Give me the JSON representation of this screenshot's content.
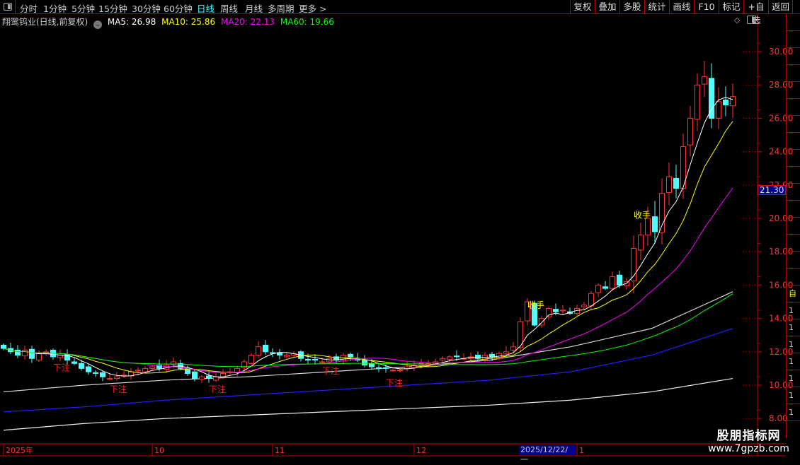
{
  "toolbar": {
    "periods": [
      "分时",
      "1分钟",
      "5分钟",
      "15分钟",
      "30分钟",
      "60分钟",
      "日线",
      "周线",
      "月线",
      "多周期",
      "更多 >"
    ],
    "active_period": "日线",
    "buttons": [
      "复权",
      "叠加",
      "多股",
      "统计",
      "画线",
      "F10",
      "标记",
      "+自选",
      "返回"
    ]
  },
  "info": {
    "title": "翔鹭钨业(日线,前复权)",
    "ma5": "MA5: 26.98",
    "ma10": "MA10: 25.86",
    "ma20": "MA20: 22.13",
    "ma60": "MA60: 19.66"
  },
  "colors": {
    "up": "#ff3232",
    "down": "#54fcfc",
    "ma5": "#ffffff",
    "ma10": "#ffff00",
    "ma20": "#ff00ff",
    "ma60": "#00ff00",
    "axis": "#ff3232",
    "signal_buy": "#ff2020",
    "signal_sell": "#ffff00"
  },
  "price_tag": "21.30",
  "date_tag": "2025/12/22/一",
  "right_strip": [
    "自",
    "1",
    "1",
    "1",
    "1",
    "1",
    "1",
    "1"
  ],
  "watermark": {
    "line1": "股朋指标网",
    "line2": "www.7gpzb.com"
  },
  "chart_data": {
    "type": "candlestick",
    "ylim": [
      7.5,
      31.5
    ],
    "yticks": [
      "8.00",
      "10.00",
      "12.00",
      "14.00",
      "16.00",
      "18.00",
      "20.00",
      "22.00",
      "24.00",
      "26.00",
      "28.00",
      "30.00"
    ],
    "xticks": [
      {
        "index": 0,
        "label": "2025年"
      },
      {
        "index": 21,
        "label": "10"
      },
      {
        "index": 38,
        "label": "11"
      },
      {
        "index": 58,
        "label": "12"
      },
      {
        "index": 81,
        "label": "1"
      }
    ],
    "closes": [
      12.2,
      12.0,
      11.8,
      12.1,
      11.6,
      11.9,
      12.0,
      11.7,
      11.8,
      11.5,
      11.3,
      11.0,
      10.8,
      10.7,
      10.5,
      10.4,
      10.5,
      10.6,
      10.8,
      10.9,
      11.0,
      11.1,
      11.0,
      11.2,
      11.4,
      11.0,
      10.7,
      10.4,
      10.5,
      10.4,
      10.5,
      10.7,
      10.8,
      11.0,
      11.4,
      11.8,
      12.3,
      12.0,
      11.9,
      11.8,
      11.8,
      11.9,
      11.6,
      11.5,
      11.5,
      11.4,
      11.6,
      11.5,
      11.8,
      11.7,
      11.5,
      11.2,
      11.1,
      11.0,
      11.0,
      10.9,
      10.9,
      11.1,
      11.2,
      11.3,
      11.3,
      11.4,
      11.6,
      11.7,
      11.7,
      11.6,
      11.7,
      11.6,
      11.8,
      11.7,
      11.9,
      12.0,
      12.3,
      13.8,
      15.0,
      13.6,
      14.0,
      14.6,
      14.4,
      14.5,
      14.3,
      14.6,
      14.8,
      15.5,
      16.0,
      15.8,
      16.5,
      16.0,
      16.2,
      18.2,
      19.0,
      20.0,
      19.2,
      21.5,
      22.5,
      21.8,
      24.3,
      26.0,
      28.0,
      28.5,
      26.0,
      27.0,
      26.8,
      27.3
    ],
    "long_lines": [
      {
        "name": "MA120",
        "color": "#d8d8d8",
        "values": [
          9.6,
          10.0,
          10.3,
          10.5,
          10.8,
          11.1,
          11.5,
          12.3,
          13.4,
          15.6
        ]
      },
      {
        "name": "MA250",
        "color": "#2020ff",
        "values": [
          8.4,
          8.7,
          9.1,
          9.4,
          9.7,
          10.0,
          10.3,
          10.8,
          11.8,
          13.4
        ]
      },
      {
        "name": "MA500",
        "color": "#eeeeee",
        "values": [
          7.3,
          7.7,
          8.0,
          8.2,
          8.4,
          8.6,
          8.8,
          9.1,
          9.6,
          10.4
        ]
      }
    ],
    "signals": [
      {
        "index": 8,
        "text": "下注",
        "type": "buy"
      },
      {
        "index": 16,
        "text": "下注",
        "type": "buy"
      },
      {
        "index": 30,
        "text": "下注",
        "type": "buy"
      },
      {
        "index": 46,
        "text": "下注",
        "type": "buy"
      },
      {
        "index": 55,
        "text": "下注",
        "type": "buy"
      },
      {
        "index": 75,
        "text": "收手",
        "type": "sell"
      },
      {
        "index": 90,
        "text": "收手",
        "type": "sell"
      }
    ]
  }
}
